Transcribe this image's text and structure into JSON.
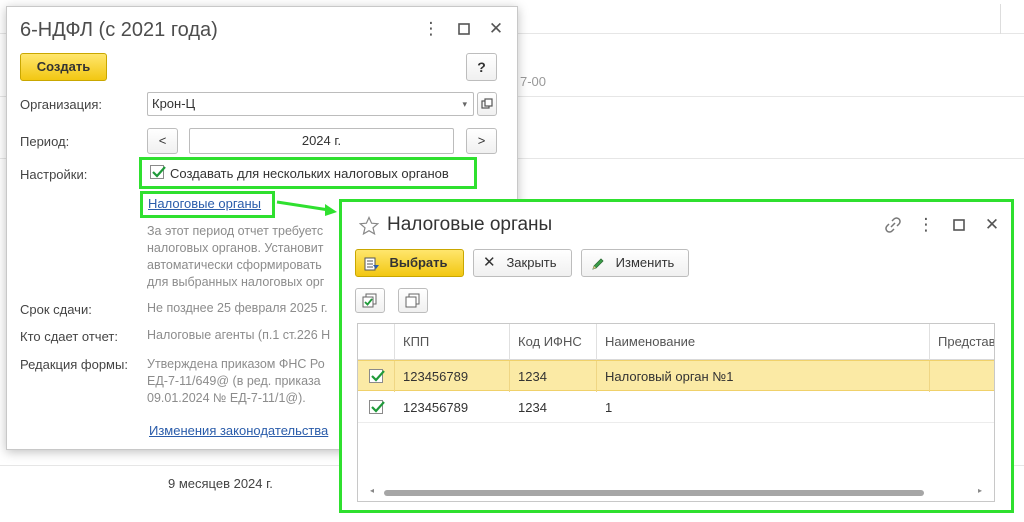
{
  "background": {
    "texts": [
      {
        "text": "7-00",
        "faint": true
      },
      {
        "text": "9 месяцев 2024 г.",
        "faint": false
      }
    ]
  },
  "main_dialog": {
    "title": "6-НДФЛ (с 2021 года)",
    "create_button": "Создать",
    "help_button": "?",
    "organization": {
      "label": "Организация:",
      "value": "Крон-Ц"
    },
    "period": {
      "label": "Период:",
      "value": "2024 г.",
      "prev": "<",
      "next": ">"
    },
    "settings": {
      "label": "Настройки:",
      "checkbox_label": "Создавать для нескольких налоговых органов",
      "checked": true
    },
    "tax_authorities_link": "Налоговые органы",
    "description_lines": [
      "За этот период отчет требуетс",
      "налоговых органов. Установит",
      "автоматически сформировать",
      "для выбранных налоговых орг"
    ],
    "deadline": {
      "label": "Срок сдачи:",
      "value": "Не позднее 25 февраля 2025 г."
    },
    "who_submits": {
      "label": "Кто сдает отчет:",
      "value": "Налоговые агенты (п.1 ст.226 Н"
    },
    "form_edition": {
      "label": "Редакция формы:",
      "lines": [
        "Утверждена приказом ФНС Ро",
        "ЕД-7-11/649@ (в ред. приказа",
        "09.01.2024 № ЕД-7-11/1@)."
      ]
    },
    "law_changes_link": "Изменения законодательства"
  },
  "tax_dialog": {
    "title": "Налоговые органы",
    "toolbar": {
      "select": "Выбрать",
      "close": "Закрыть",
      "edit": "Изменить"
    },
    "table": {
      "headers": [
        "КПП",
        "Код ИФНС",
        "Наименование",
        "Представ"
      ],
      "rows": [
        {
          "checked": true,
          "kpp": "123456789",
          "ifns": "1234",
          "name": "Налоговый орган №1",
          "selected": true
        },
        {
          "checked": true,
          "kpp": "123456789",
          "ifns": "1234",
          "name": "1",
          "selected": false
        }
      ]
    }
  },
  "colors": {
    "highlight": "#2fe02f",
    "accent_yellow": "#f5d23a",
    "link": "#2a5caa",
    "row_selected": "#fbeaa5"
  }
}
